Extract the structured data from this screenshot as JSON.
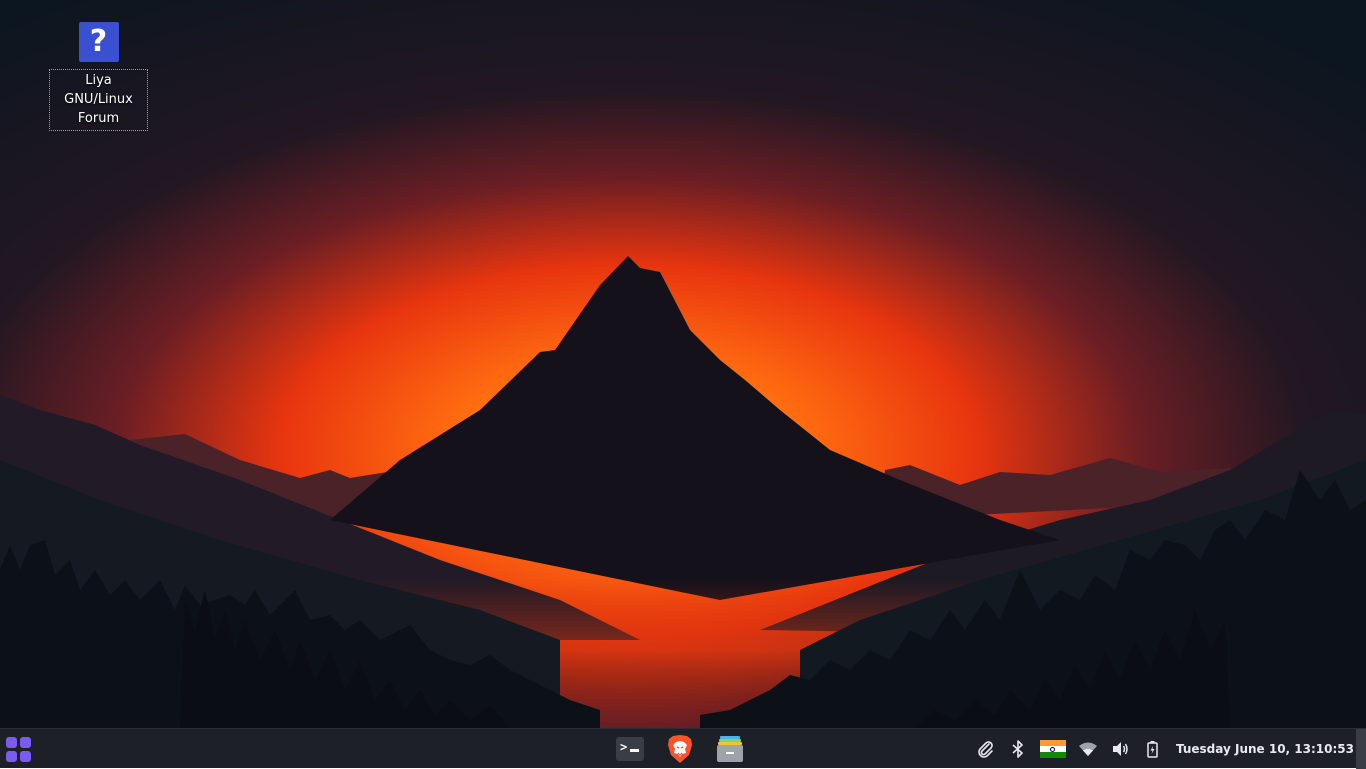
{
  "desktop": {
    "icons": [
      {
        "label": "Liya GNU/Linux Forum",
        "glyph": "?",
        "icon": "help-icon"
      }
    ]
  },
  "taskbar": {
    "app_menu_icon": "app-grid-icon",
    "dock": [
      {
        "icon": "terminal-icon"
      },
      {
        "icon": "brave-browser-icon"
      },
      {
        "icon": "file-manager-icon"
      }
    ],
    "tray": {
      "icons": [
        "paperclip-icon",
        "bluetooth-icon",
        "keyboard-layout-flag-icon",
        "wifi-icon",
        "volume-icon",
        "battery-icon"
      ],
      "clock": "Tuesday June 10, 13:10:53"
    }
  },
  "colors": {
    "accent": "#7b5cf0",
    "taskbar_bg": "#1e2028",
    "sky_glow": "#ff5a14"
  }
}
